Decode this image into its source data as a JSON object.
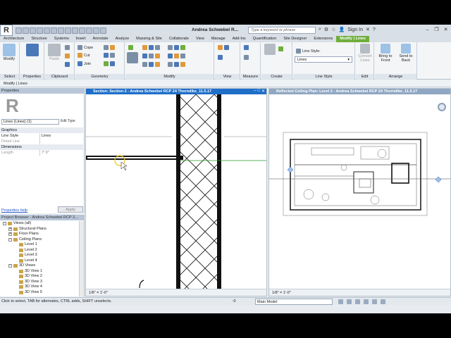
{
  "titlebar": {
    "app_icon": "R",
    "document_title": "Andrea Schwebel R...",
    "search_placeholder": "Type a keyword or phrase",
    "sign_in": "Sign In"
  },
  "tabs": [
    "Architecture",
    "Structure",
    "Systems",
    "Insert",
    "Annotate",
    "Analyze",
    "Massing & Site",
    "Collaborate",
    "View",
    "Manage",
    "Add-Ins",
    "Quantification",
    "Site Designer",
    "Extensions",
    "Modify | Lines"
  ],
  "active_tab": "Modify | Lines",
  "ribbon": {
    "select_label": "Select",
    "modify_label": "Modify",
    "panels": {
      "properties": "Properties",
      "clipboard": "Clipboard",
      "geometry": "Geometry",
      "modify": "Modify",
      "view": "View",
      "measure": "Measure",
      "create": "Create",
      "line_style": "Line Style",
      "edit": "Edit",
      "arrange": "Arrange"
    },
    "clipboard": {
      "paste": "Paste",
      "cope": "Cope",
      "cut": "Cut",
      "join": "Join"
    },
    "line_style_label": "Line Style:",
    "line_style_value": "Lines",
    "edit": {
      "convert_lines": "Convert Lines"
    },
    "arrange": {
      "bring_to_front": "Bring to Front",
      "send_to_back": "Send to Back"
    }
  },
  "context_bar": "Modify | Lines",
  "properties": {
    "header": "Properties",
    "type_selector": "Lines (Lines) (1)",
    "edit_type": "Edit Type",
    "graphics_section": "Graphics",
    "line_style_key": "Line Style",
    "line_style_value": "Lines",
    "detail_line_key": "Detail Line",
    "dimensions_section": "Dimensions",
    "length_key": "Length",
    "length_value": "7'  0\"",
    "help_link": "Properties help",
    "apply": "Apply"
  },
  "browser": {
    "header": "Project Browser - Andrea Schwebel RCP 2...",
    "nodes": [
      {
        "label": "Views (all)",
        "level": 0,
        "exp": "-"
      },
      {
        "label": "Structural Plans",
        "level": 1,
        "exp": "+"
      },
      {
        "label": "Floor Plans",
        "level": 1,
        "exp": "+"
      },
      {
        "label": "Ceiling Plans",
        "level": 1,
        "exp": "-"
      },
      {
        "label": "Level 1",
        "level": 2,
        "exp": ""
      },
      {
        "label": "Level 2",
        "level": 2,
        "exp": ""
      },
      {
        "label": "Level 3",
        "level": 2,
        "exp": ""
      },
      {
        "label": "Level 4",
        "level": 2,
        "exp": ""
      },
      {
        "label": "3D Views",
        "level": 1,
        "exp": "-"
      },
      {
        "label": "3D View 1",
        "level": 2,
        "exp": ""
      },
      {
        "label": "3D View 2",
        "level": 2,
        "exp": ""
      },
      {
        "label": "3D View 3",
        "level": 2,
        "exp": ""
      },
      {
        "label": "3D View 4",
        "level": 2,
        "exp": ""
      },
      {
        "label": "3D View 5",
        "level": 2,
        "exp": ""
      }
    ]
  },
  "section_view": {
    "title": "Section: Section 2 - Andrea Schwebel RCP 24 Thorndike_11.5.17",
    "scale": "1/8\" = 1'-0\""
  },
  "rcp_view": {
    "title": "Reflected Ceiling Plan: Level 2 - Andrea Schwebel RCP 24 Thorndike_11.5.17",
    "scale": "1/8\" = 1'-0\""
  },
  "statusbar": {
    "message": "Click to select, TAB for alternates, CTRL adds, SHIFT unselects.",
    "zero": ":0",
    "model": "Main Model"
  }
}
